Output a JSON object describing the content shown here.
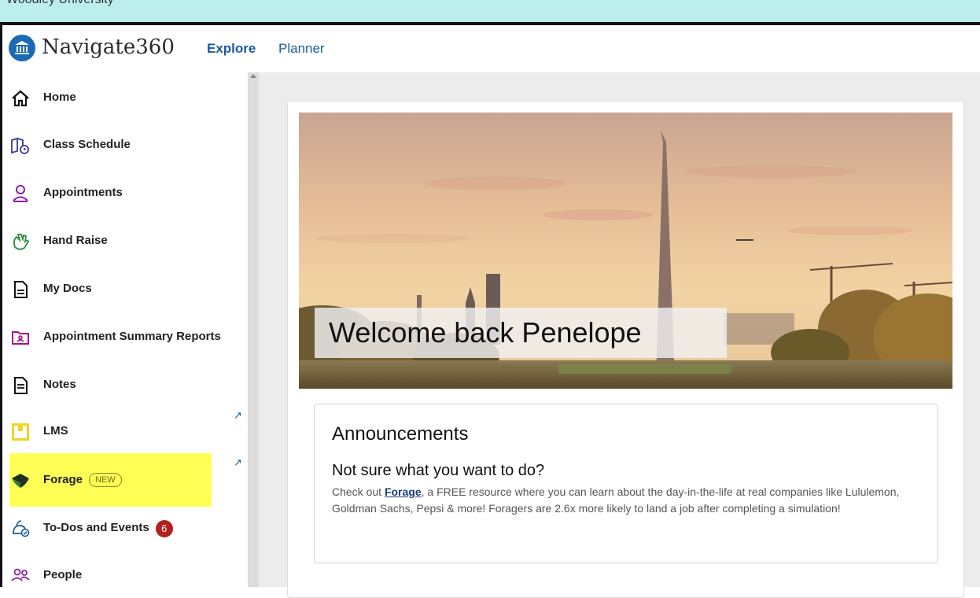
{
  "window": {
    "title": "Woodley University"
  },
  "header": {
    "brand": "Navigate360",
    "tabs": [
      {
        "label": "Explore"
      },
      {
        "label": "Planner"
      }
    ]
  },
  "sidebar": {
    "items": [
      {
        "label": "Home",
        "icon": "home-icon"
      },
      {
        "label": "Class Schedule",
        "icon": "class-schedule-icon"
      },
      {
        "label": "Appointments",
        "icon": "person-icon"
      },
      {
        "label": "Hand Raise",
        "icon": "hand-raise-icon"
      },
      {
        "label": "My Docs",
        "icon": "document-icon"
      },
      {
        "label": "Appointment Summary Reports",
        "icon": "folder-report-icon"
      },
      {
        "label": "Notes",
        "icon": "notes-icon"
      },
      {
        "label": "LMS",
        "icon": "lms-icon"
      },
      {
        "label": "Forage",
        "icon": "forage-icon",
        "pill": "NEW"
      },
      {
        "label": "To-Dos and Events",
        "icon": "todo-icon",
        "badge": "6"
      },
      {
        "label": "People",
        "icon": "people-icon"
      }
    ],
    "external_arrow": "↗"
  },
  "hero": {
    "welcome": "Welcome back Penelope"
  },
  "announcements": {
    "heading": "Announcements",
    "subheading": "Not sure what you want to do?",
    "text_before": "Check out ",
    "link": "Forage",
    "text_after": ", a FREE resource where you can learn about the day-in-the-life at real companies like Lululemon, Goldman Sachs, Pepsi & more! Foragers are 2.6x more likely to land a job after completing a simulation!"
  },
  "colors": {
    "brand_blue": "#1b6ab3",
    "nav_blue": "#1b5a9c",
    "highlight": "#ffff55",
    "badge_red": "#b22020",
    "window_strip": "#bdeeee"
  }
}
